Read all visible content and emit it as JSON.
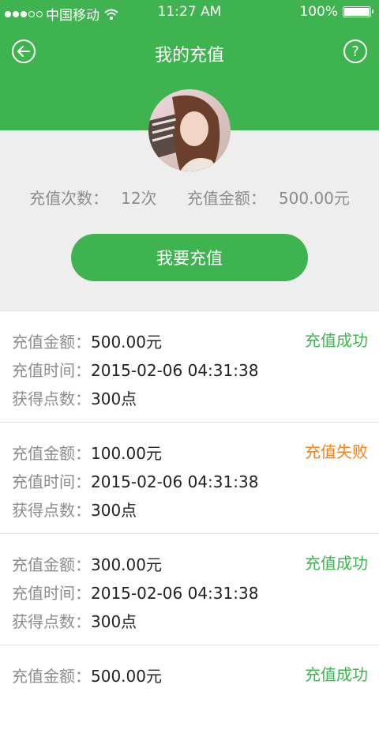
{
  "status_bar": {
    "carrier": "中国移动",
    "time": "11:27 AM",
    "battery": "100%",
    "battery_level": 1.0,
    "signal_bars": 3,
    "signal_total": 5
  },
  "header": {
    "title": "我的充值",
    "back_icon": "back-arrow-icon",
    "help_icon": "help-icon",
    "help_glyph": "?"
  },
  "profile": {
    "recharge_count_label": "充值次数：",
    "recharge_count": "12次",
    "recharge_amount_label": "充值金额：",
    "recharge_amount": "500.00元"
  },
  "action": {
    "button_label": "我要充值"
  },
  "labels": {
    "amount": "充值金额：",
    "time": "充值时间：",
    "points": "获得点数："
  },
  "records": [
    {
      "amount": "500.00元",
      "time": "2015-02-06 04:31:38",
      "points": "300点",
      "status": "充值成功",
      "status_color": "#3fb34f"
    },
    {
      "amount": "100.00元",
      "time": "2015-02-06 04:31:38",
      "points": "300点",
      "status": "充值失败",
      "status_color": "#f5821f"
    },
    {
      "amount": "300.00元",
      "time": "2015-02-06 04:31:38",
      "points": "300点",
      "status": "充值成功",
      "status_color": "#3fb34f"
    },
    {
      "amount": "500.00元",
      "time": "",
      "points": "",
      "status": "充值成功",
      "status_color": "#3fb34f"
    }
  ],
  "colors": {
    "brand_green": "#3fb34f",
    "fail_orange": "#f5821f",
    "panel_gray": "#eeeeee"
  }
}
